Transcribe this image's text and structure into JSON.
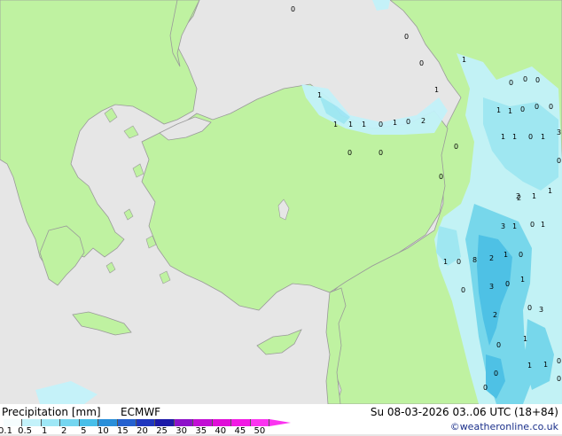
{
  "legend": {
    "title": "Precipitation [mm]",
    "model": "ECMWF",
    "ticks": [
      "0.1",
      "0.5",
      "1",
      "2",
      "5",
      "10",
      "15",
      "20",
      "25",
      "30",
      "35",
      "40",
      "45",
      "50"
    ],
    "colors": [
      "#f5fdfe",
      "#c3f2fa",
      "#9ee7f6",
      "#74d6f0",
      "#48bfe9",
      "#2a8fd9",
      "#2461cf",
      "#1f36be",
      "#1c19a8",
      "#8d12c9",
      "#c20fd4",
      "#e00ed8",
      "#f21ae4",
      "#fb34f0"
    ]
  },
  "run": {
    "datetime": "Su 08-03-2026 03..06 UTC (18+84)"
  },
  "credit": "©weatheronline.co.uk",
  "map": {
    "land_color": "#bff2a1",
    "sea_color": "#e6e6e6",
    "border_color": "#9a9a9a",
    "point_labels": [
      {
        "v": "0",
        "id": "p1"
      },
      {
        "v": "0",
        "id": "p2"
      },
      {
        "v": "0",
        "id": "p3"
      },
      {
        "v": "1",
        "id": "p4"
      },
      {
        "v": "1",
        "id": "p5"
      },
      {
        "v": "1",
        "id": "p6"
      },
      {
        "v": "1",
        "id": "p7"
      },
      {
        "v": "1",
        "id": "p8"
      },
      {
        "v": "1",
        "id": "p9"
      },
      {
        "v": "0",
        "id": "p10"
      },
      {
        "v": "1",
        "id": "p11"
      },
      {
        "v": "0",
        "id": "p12"
      },
      {
        "v": "2",
        "id": "p13"
      },
      {
        "v": "0",
        "id": "p14"
      },
      {
        "v": "0",
        "id": "p15"
      },
      {
        "v": "0",
        "id": "p16"
      },
      {
        "v": "0",
        "id": "p17"
      },
      {
        "v": "0",
        "id": "p18"
      },
      {
        "v": "0",
        "id": "p19"
      },
      {
        "v": "0",
        "id": "p20"
      },
      {
        "v": "1",
        "id": "p21"
      },
      {
        "v": "1",
        "id": "p22"
      },
      {
        "v": "0",
        "id": "p23"
      },
      {
        "v": "0",
        "id": "p24"
      },
      {
        "v": "0",
        "id": "p25"
      },
      {
        "v": "3",
        "id": "p26"
      },
      {
        "v": "1",
        "id": "p27"
      },
      {
        "v": "1",
        "id": "p28"
      },
      {
        "v": "0",
        "id": "p29"
      },
      {
        "v": "1",
        "id": "p30"
      },
      {
        "v": "0",
        "id": "p31"
      },
      {
        "v": "2",
        "id": "p32"
      },
      {
        "v": "1",
        "id": "p33"
      },
      {
        "v": "1",
        "id": "p34"
      },
      {
        "v": "3",
        "id": "p35"
      },
      {
        "v": "1",
        "id": "p36"
      },
      {
        "v": "0",
        "id": "p37"
      },
      {
        "v": "1",
        "id": "p38"
      },
      {
        "v": "1",
        "id": "p39"
      },
      {
        "v": "0",
        "id": "p40"
      },
      {
        "v": "8",
        "id": "p41"
      },
      {
        "v": "2",
        "id": "p42"
      },
      {
        "v": "1",
        "id": "p43"
      },
      {
        "v": "0",
        "id": "p44"
      },
      {
        "v": "3",
        "id": "p45"
      },
      {
        "v": "0",
        "id": "p46"
      },
      {
        "v": "1",
        "id": "p47"
      },
      {
        "v": "2",
        "id": "p48"
      },
      {
        "v": "0",
        "id": "p49"
      },
      {
        "v": "3",
        "id": "p50"
      },
      {
        "v": "0",
        "id": "p51"
      },
      {
        "v": "1",
        "id": "p52"
      },
      {
        "v": "0",
        "id": "p53"
      },
      {
        "v": "0",
        "id": "p54"
      },
      {
        "v": "1",
        "id": "p55"
      },
      {
        "v": "0",
        "id": "p56"
      },
      {
        "v": "1",
        "id": "p57"
      },
      {
        "v": "0",
        "id": "p58"
      },
      {
        "v": "0",
        "id": "p59"
      },
      {
        "v": "2",
        "id": "p60"
      }
    ]
  }
}
